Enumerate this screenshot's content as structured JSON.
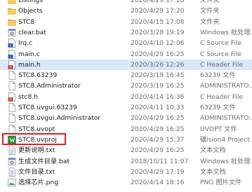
{
  "files": [
    {
      "name": "Listings",
      "date": "2020/4/29 17:20",
      "type": "文件夹",
      "icon": "folder-icon",
      "partial": true
    },
    {
      "name": "Objects",
      "date": "2020/4/29 17:20",
      "type": "文件夹",
      "icon": "folder-icon"
    },
    {
      "name": "STC8",
      "date": "2020/4/15 17:08",
      "type": "文件夹",
      "icon": "folder-icon"
    },
    {
      "name": "clear.bat",
      "date": "2020/3/28 19:19",
      "type": "Windows 批处理...",
      "icon": "batch-file-icon"
    },
    {
      "name": "Irq.c",
      "date": "2020/4/10 12:06",
      "type": "C Source File",
      "icon": "c-source-file-icon"
    },
    {
      "name": "main.c",
      "date": "2020/4/29 16:25",
      "type": "C Source File",
      "icon": "c-source-file-icon"
    },
    {
      "name": "main.h",
      "date": "2020/3/26 12:26",
      "type": "C Header File",
      "icon": "c-header-file-icon",
      "selected": true
    },
    {
      "name": "STC8.63239",
      "date": "2020/3/19 16:45",
      "type": "63239 文件",
      "icon": "blank-file-icon"
    },
    {
      "name": "STC8.Administrator",
      "date": "2020/3/19 16:25",
      "type": "ADMINISTRATO...",
      "icon": "blank-file-icon"
    },
    {
      "name": "stc8.h",
      "date": "2020/4/14 16:36",
      "type": "C Header File",
      "icon": "c-header-file-icon"
    },
    {
      "name": "STC8.uvgui.63239",
      "date": "2020/4/11 10:33",
      "type": "63239 文件",
      "icon": "blank-file-icon"
    },
    {
      "name": "STC8.uvgui.Administrator",
      "date": "2020/4/29 16:25",
      "type": "ADMINISTRATO...",
      "icon": "blank-file-icon"
    },
    {
      "name": "STC8.uvopt",
      "date": "2020/4/29 16:25",
      "type": "UVOPT 文件",
      "icon": "blank-file-icon"
    },
    {
      "name": "STC8.uvproj",
      "date": "2020/4/29 15:37",
      "type": "礦ision4 Project",
      "icon": "uvision-project-icon",
      "highlighted": true
    },
    {
      "name": "更新说明.txt",
      "date": "2020/4/29 16:25",
      "type": "文本文档",
      "icon": "text-file-icon"
    },
    {
      "name": "生成文件目录.bat",
      "date": "2018/10/11 11:07",
      "type": "Windows 批处理...",
      "icon": "batch-file-icon"
    },
    {
      "name": "文件目录.txt",
      "date": "2020/4/29 17:19",
      "type": "文本文档",
      "icon": "text-file-icon"
    },
    {
      "name": "选择芯片.png",
      "date": "2020/4/14 18:16",
      "type": "PNG 图片文件",
      "icon": "png-image-icon",
      "partial": true
    }
  ],
  "colors": {
    "folder": "#e8b53c",
    "highlight_border": "#e02020",
    "selected_row": "#d9e8fb",
    "secondary_text": "#6d6d6d"
  }
}
